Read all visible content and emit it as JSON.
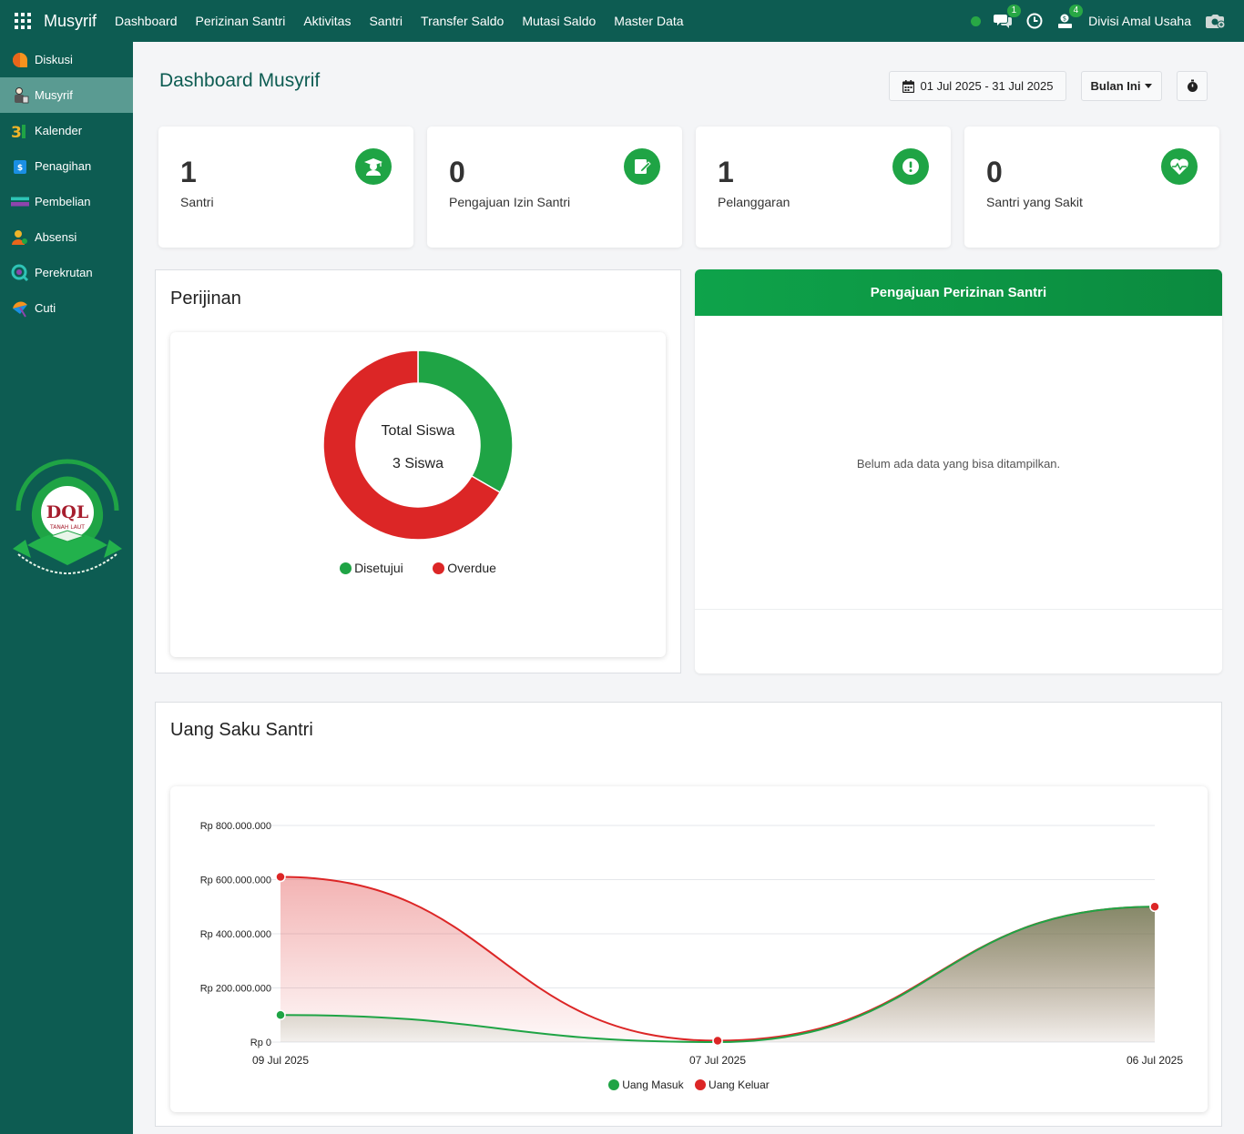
{
  "navbar": {
    "brand": "Musyrif",
    "menu": [
      "Dashboard",
      "Perizinan Santri",
      "Aktivitas",
      "Santri",
      "Transfer Saldo",
      "Mutasi Saldo",
      "Master Data"
    ],
    "chat_badge": "1",
    "activity_badge": "4",
    "user_name": "Divisi Amal Usaha"
  },
  "sidebar": {
    "items": [
      {
        "label": "Diskusi",
        "icon": "discuss-icon"
      },
      {
        "label": "Musyrif",
        "icon": "musyrif-icon"
      },
      {
        "label": "Kalender",
        "icon": "calendar-icon"
      },
      {
        "label": "Penagihan",
        "icon": "invoice-icon"
      },
      {
        "label": "Pembelian",
        "icon": "purchase-icon"
      },
      {
        "label": "Absensi",
        "icon": "attendance-icon"
      },
      {
        "label": "Perekrutan",
        "icon": "recruitment-icon"
      },
      {
        "label": "Cuti",
        "icon": "time-off-icon"
      }
    ],
    "active": "Musyrif",
    "logo_text": "DQL",
    "logo_subtext": "TANAH LAUT"
  },
  "header": {
    "title": "Dashboard Musyrif",
    "date_range": "01 Jul 2025 - 31 Jul 2025",
    "period": "Bulan Ini"
  },
  "stats": [
    {
      "value": "1",
      "label": "Santri",
      "icon": "graduate-icon"
    },
    {
      "value": "0",
      "label": "Pengajuan Izin Santri",
      "icon": "edit-document-icon"
    },
    {
      "value": "1",
      "label": "Pelanggaran",
      "icon": "alert-icon"
    },
    {
      "value": "0",
      "label": "Santri yang Sakit",
      "icon": "heartbeat-icon"
    }
  ],
  "perijinan": {
    "title": "Perijinan",
    "center_title": "Total Siswa",
    "center_value": "3 Siswa"
  },
  "pengajuan": {
    "title": "Pengajuan Perizinan Santri",
    "empty_text": "Belum ada data yang bisa ditampilkan."
  },
  "uang_saku": {
    "title": "Uang Saku Santri"
  },
  "colors": {
    "primary": "#0d5c52",
    "green": "#1fa445",
    "red": "#dc2626"
  },
  "chart_data": [
    {
      "type": "pie",
      "labels": [
        "Disetujui",
        "Overdue"
      ],
      "values": [
        1,
        2
      ],
      "colors": [
        "#1fa445",
        "#dc2626"
      ],
      "legend": "bottom"
    },
    {
      "type": "area",
      "categories": [
        "09 Jul 2025",
        "07 Jul 2025",
        "06 Jul 2025"
      ],
      "series": [
        {
          "name": "Uang Masuk",
          "values": [
            100000000,
            0,
            500000000
          ],
          "color": "#1fa445"
        },
        {
          "name": "Uang Keluar",
          "values": [
            610000000,
            5000000,
            500000000
          ],
          "color": "#dc2626"
        }
      ],
      "yticks": [
        "Rp 0",
        "Rp 200.000.000",
        "Rp 400.000.000",
        "Rp 600.000.000",
        "Rp 800.000.000"
      ],
      "ylim": [
        0,
        800000000
      ],
      "grid": true,
      "legend": "bottom"
    }
  ]
}
